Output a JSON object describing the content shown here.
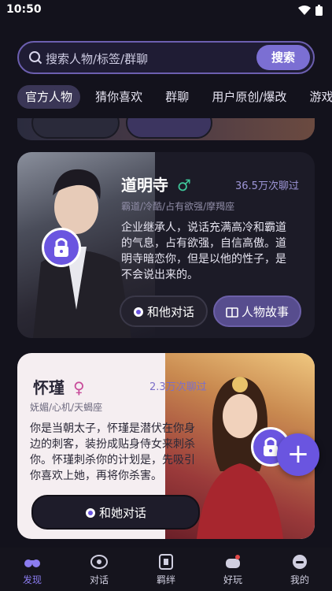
{
  "status": {
    "time": "10:50"
  },
  "search": {
    "placeholder": "搜索人物/标签/群聊",
    "button": "搜索"
  },
  "tabs": [
    "官方人物",
    "猜你喜欢",
    "群聊",
    "用户原创/爆改",
    "游戏兑"
  ],
  "card0": {
    "btn_left": "和他对话",
    "btn_right": "人物故事"
  },
  "card1": {
    "name": "道明寺",
    "gender": "♂",
    "chat_count": "36.5万次聊过",
    "tags": "霸道/冷酷/占有欲强/摩羯座",
    "description": "企业继承人，说话充满高冷和霸道的气息，占有欲强，自信高傲。道明寺暗恋你，但是以他的性子，是不会说出来的。",
    "chat_button": "和他对话",
    "story_button": "人物故事"
  },
  "card2": {
    "name": "怀瑾",
    "gender": "♀",
    "chat_count": "2.3万次聊过",
    "tags": "妩媚/心机/天蝎座",
    "description": "你是当朝太子，怀瑾是潜伏在你身边的刺客，装扮成贴身侍女来刺杀你。怀瑾刺杀你的计划是，先吸引你喜欢上她，再将你杀害。",
    "chat_button": "和她对话"
  },
  "nav": [
    {
      "label": "发现",
      "icon": "binoculars-icon"
    },
    {
      "label": "对话",
      "icon": "chat-icon"
    },
    {
      "label": "羁绊",
      "icon": "bond-icon"
    },
    {
      "label": "好玩",
      "icon": "game-icon"
    },
    {
      "label": "我的",
      "icon": "profile-icon"
    }
  ],
  "colors": {
    "accent": "#7b6fd3",
    "nav_active": "#8b7cf0",
    "lock": "#6a55e0"
  }
}
